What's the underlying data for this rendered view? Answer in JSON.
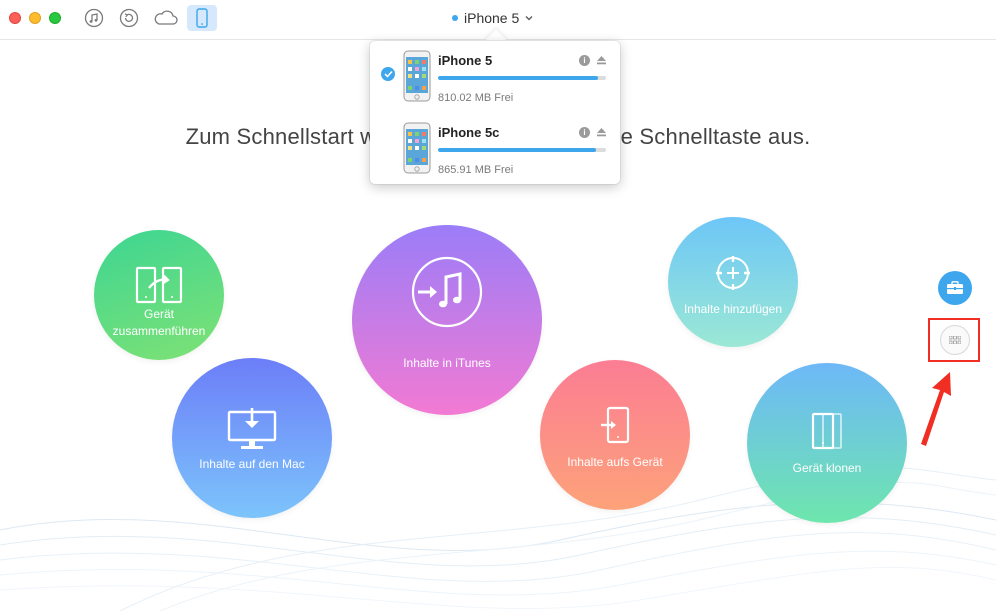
{
  "window": {
    "device_selector": {
      "label": "iPhone 5",
      "status_color": "#3da6ec"
    },
    "toolbar_icons": [
      "itunes-icon",
      "backup-icon",
      "icloud-icon",
      "device-icon"
    ]
  },
  "headline": {
    "left": "Zum Schnellstart w",
    "right": "ne Schnelltaste aus."
  },
  "device_menu": {
    "devices": [
      {
        "name": "iPhone 5",
        "free": "810.02 MB Frei",
        "used_fraction": 0.95,
        "selected": true
      },
      {
        "name": "iPhone 5c",
        "free": "865.91 MB Frei",
        "used_fraction": 0.94,
        "selected": false
      }
    ],
    "info_glyph": "i"
  },
  "quick_actions": {
    "merge": {
      "label_line1": "Gerät",
      "label_line2": "zusammenführen"
    },
    "to_mac": {
      "label": "Inhalte auf den Mac"
    },
    "to_itunes": {
      "label": "Inhalte in iTunes"
    },
    "to_device": {
      "label": "Inhalte aufs Gerät"
    },
    "add_content": {
      "label": "Inhalte hinzufügen"
    },
    "clone": {
      "label": "Gerät klonen"
    }
  },
  "colors": {
    "accent": "#3da6ec",
    "highlight": "#f12e24"
  }
}
